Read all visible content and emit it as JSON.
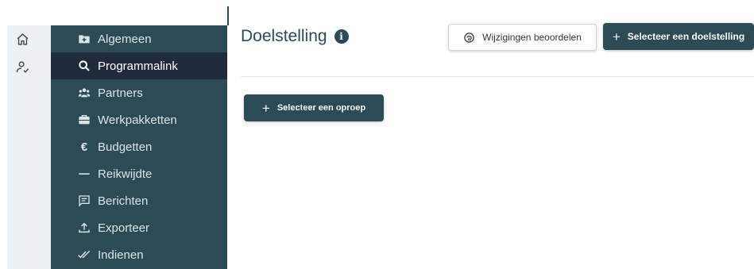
{
  "rail": {
    "items": [
      {
        "icon": "home-icon"
      },
      {
        "icon": "user-check-icon"
      }
    ]
  },
  "sidebar": {
    "items": [
      {
        "label": "Algemeen",
        "icon": "folder-plus-icon",
        "active": false
      },
      {
        "label": "Programmalink",
        "icon": "search-icon",
        "active": true
      },
      {
        "label": "Partners",
        "icon": "users-icon",
        "active": false
      },
      {
        "label": "Werkpakketten",
        "icon": "briefcase-icon",
        "active": false
      },
      {
        "label": "Budgetten",
        "icon": "euro-icon",
        "active": false
      },
      {
        "label": "Reikwijdte",
        "icon": "dash-icon",
        "active": false
      },
      {
        "label": "Berichten",
        "icon": "message-icon",
        "active": false
      },
      {
        "label": "Exporteer",
        "icon": "upload-icon",
        "active": false
      },
      {
        "label": "Indienen",
        "icon": "double-check-icon",
        "active": false
      }
    ]
  },
  "main": {
    "title": "Doelstelling",
    "review_button": "Wijzigingen beoordelen",
    "select_goal_button": "Selecteer een doelstelling",
    "select_call_button": "Selecteer een oproep"
  },
  "colors": {
    "sidebar": "#2d4a57",
    "active": "#1f2a3c",
    "rail": "#eef1f3"
  }
}
